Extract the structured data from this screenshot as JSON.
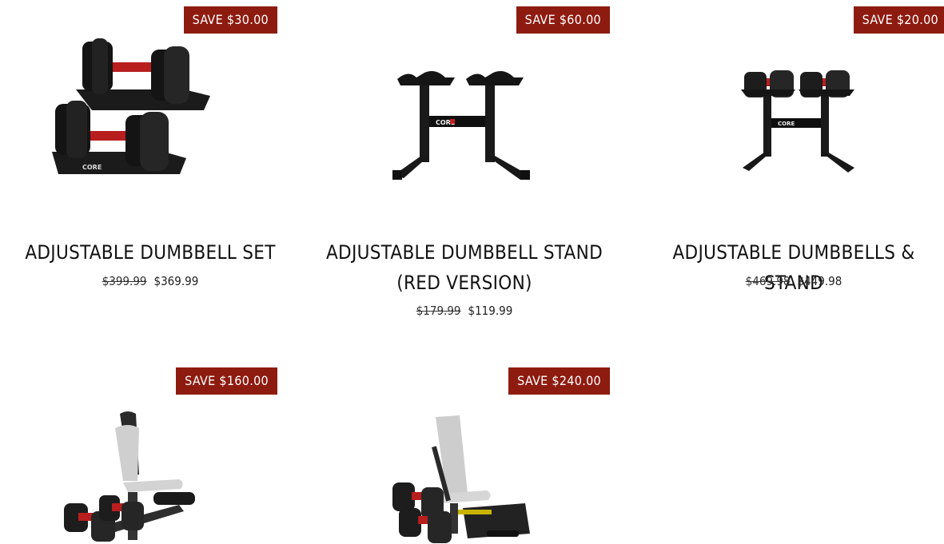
{
  "colors": {
    "badge_bg": "#8e1b10",
    "badge_text": "#ffffff",
    "text": "#111111"
  },
  "products": [
    {
      "badge": "SAVE $30.00",
      "title": "ADJUSTABLE DUMBBELL SET",
      "title_line2": "",
      "old_price": "$399.99",
      "price": "$369.99",
      "image": "adjustable-dumbbell-set"
    },
    {
      "badge": "SAVE $60.00",
      "title": "ADJUSTABLE DUMBBELL STAND",
      "title_line2": "(RED VERSION)",
      "old_price": "$179.99",
      "price": "$119.99",
      "image": "dumbbell-stand"
    },
    {
      "badge": "SAVE $20.00",
      "title": "ADJUSTABLE DUMBBELLS & STAND",
      "title_line2": "",
      "old_price": "$469.98",
      "price": "$449.98",
      "image": "dumbbells-on-stand"
    },
    {
      "badge": "SAVE $160.00",
      "image": "bench-with-dumbbells"
    },
    {
      "badge": "SAVE $240.00",
      "image": "bench-dumbbell-platform"
    }
  ]
}
